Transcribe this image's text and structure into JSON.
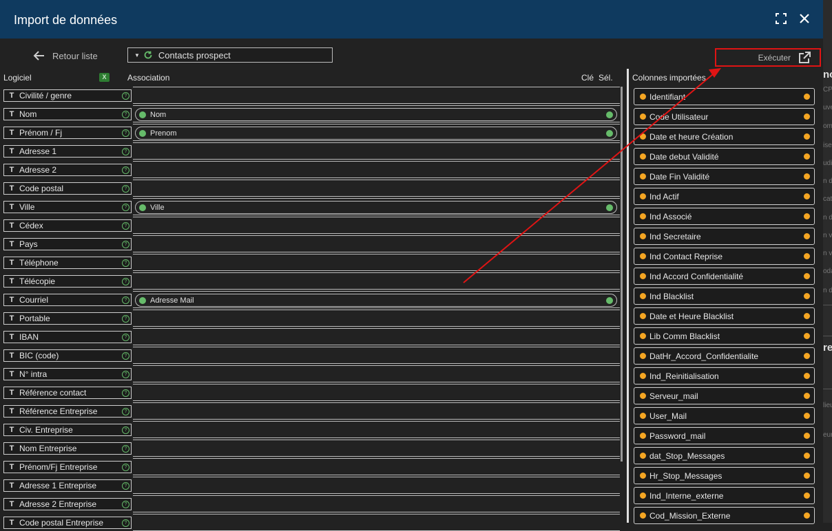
{
  "window": {
    "title": "Import de données"
  },
  "toolbar": {
    "back_label": "Retour liste",
    "preset_value": "Contacts prospect",
    "execute_label": "Exécuter"
  },
  "headers": {
    "software": "Logiciel",
    "association": "Association",
    "key": "Clé",
    "selection": "Sél.",
    "imported": "Colonnes importées"
  },
  "software_fields": [
    "Civilité / genre",
    "Nom",
    "Prénom / Fj",
    "Adresse 1",
    "Adresse 2",
    "Code postal",
    "Ville",
    "Cédex",
    "Pays",
    "Téléphone",
    "Télécopie",
    "Courriel",
    "Portable",
    "IBAN",
    "BIC (code)",
    "N° intra",
    "Référence contact",
    "Référence Entreprise",
    "Civ. Entreprise",
    "Nom Entreprise",
    "Prénom/Fj Entreprise",
    "Adresse 1 Entreprise",
    "Adresse 2 Entreprise",
    "Code postal Entreprise"
  ],
  "associations": {
    "1": "Nom",
    "2": "Prenom",
    "6": "Ville",
    "11": "Adresse Mail"
  },
  "imported_columns": [
    "Identifiant",
    "Code Utilisateur",
    "Date et heure Création",
    "Date debut Validité",
    "Date Fin Validité",
    "Ind Actif",
    "Ind Associé",
    "Ind Secretaire",
    "Ind Contact Reprise",
    "Ind Accord Confidentialité",
    "Ind Blacklist",
    "Date et Heure Blacklist",
    "Lib Comm Blacklist",
    "DatHr_Accord_Confidentialite",
    "Ind_Reinitialisation",
    "Serveur_mail",
    "User_Mail",
    "Password_mail",
    "dat_Stop_Messages",
    "Hr_Stop_Messages",
    "Ind_Interne_externe",
    "Cod_Mission_Externe"
  ],
  "background_panel": {
    "heading_1": "no",
    "heading_2": "re",
    "snippets": [
      "CP",
      "uve",
      "om",
      "ise",
      "udi",
      "n d",
      "cat",
      "n d",
      "n v",
      "n v",
      "oda",
      "n d",
      "lieu",
      "eur"
    ]
  },
  "colors": {
    "titlebar": "#0f3a5f",
    "associated_dot": "#66bb6a",
    "imported_dot": "#f5a623",
    "annotation": "#e01414"
  }
}
